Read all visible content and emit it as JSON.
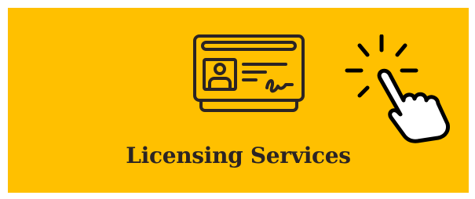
{
  "service_tile": {
    "label": "Licensing Services",
    "background_color": "#FFC000",
    "text_color": "#2B2424",
    "icons": {
      "card": "license-card-icon",
      "pointer": "click-hand-icon"
    }
  }
}
